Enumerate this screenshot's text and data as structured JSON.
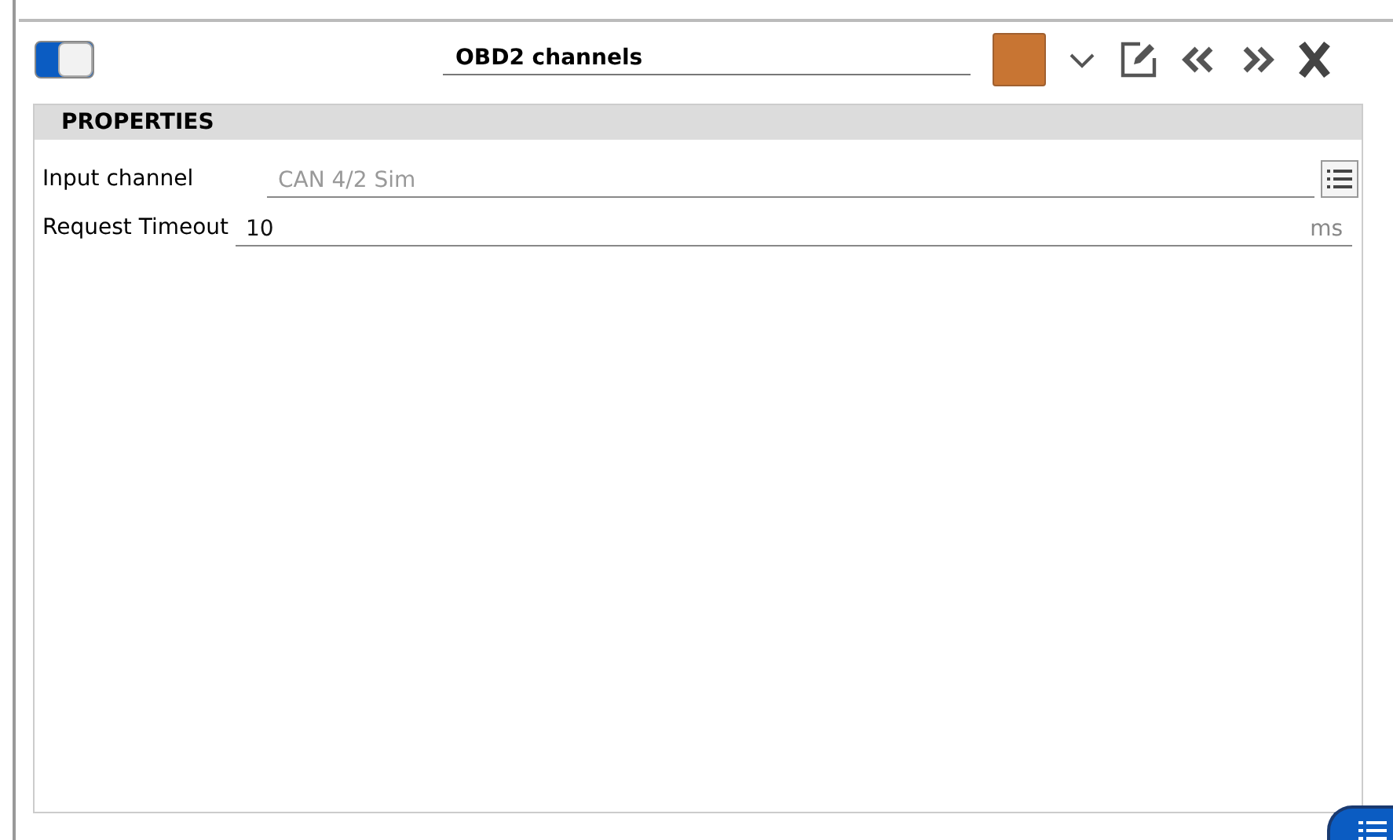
{
  "header": {
    "toggle": {
      "on": true
    },
    "title": "OBD2 channels",
    "color": "#c87533"
  },
  "properties": {
    "heading": "PROPERTIES",
    "rows": [
      {
        "kind": "select",
        "label": "Input channel",
        "value": "CAN 4/2 Sim",
        "disabled": true
      },
      {
        "kind": "number",
        "label": "Request Timeout",
        "value": "10",
        "unit": "ms",
        "disabled": false
      }
    ]
  }
}
